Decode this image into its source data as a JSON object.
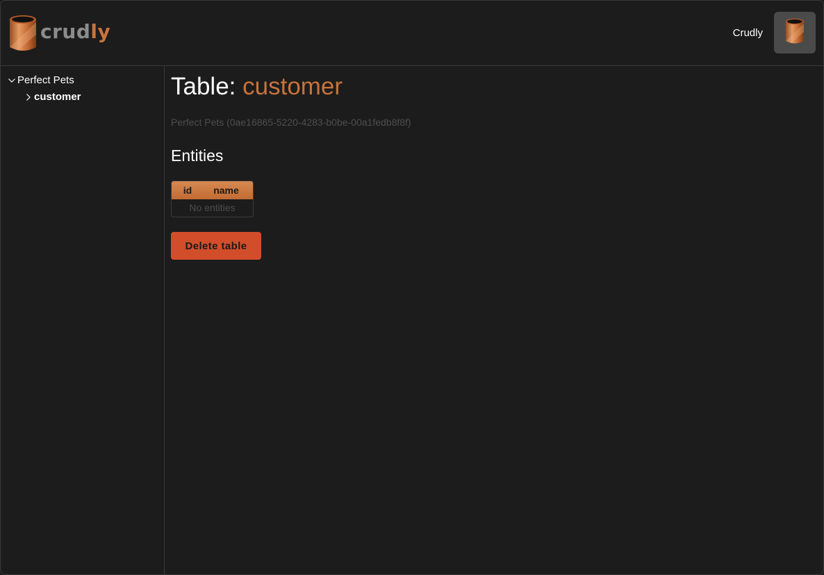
{
  "header": {
    "brand": {
      "name_part1": "crud",
      "name_part2": "ly",
      "icon": "cylinder-logo-icon"
    },
    "user_label": "Crudly",
    "avatar_icon": "cylinder-avatar-icon"
  },
  "sidebar": {
    "tree": [
      {
        "label": "Perfect Pets",
        "expanded": true,
        "icon": "chevron-down-icon",
        "children": [
          {
            "label": "customer",
            "expanded": false,
            "icon": "chevron-right-icon",
            "selected": true
          }
        ]
      }
    ]
  },
  "main": {
    "title_prefix": "Table: ",
    "title_name": "customer",
    "subtitle": "Perfect Pets (0ae16865-5220-4283-b0be-00a1fedb8f8f)",
    "entities_heading": "Entities",
    "table": {
      "columns": [
        "id",
        "name"
      ],
      "empty_message": "No entities"
    },
    "delete_label": "Delete table"
  },
  "colors": {
    "accent": "#c8733b",
    "background": "#1c1c1c",
    "danger": "#d24e2a",
    "muted_text": "#4e4e4e",
    "border": "#3a3a3a"
  }
}
